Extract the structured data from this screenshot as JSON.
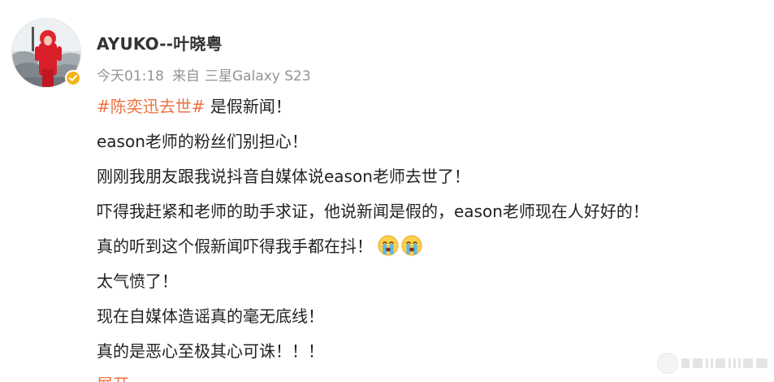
{
  "author": {
    "name": "AYUKO--叶晓粤",
    "verified_color": "#f5b319"
  },
  "meta": {
    "time": "今天01:18",
    "source_prefix": "来自",
    "device": "三星Galaxy S23"
  },
  "post": {
    "topic": "#陈奕迅去世#",
    "line1_rest": " 是假新闻！",
    "line2": "eason老师的粉丝们别担心！",
    "line3": "刚刚我朋友跟我说抖音自媒体说eason老师去世了！",
    "line4": "吓得我赶紧和老师的助手求证，他说新闻是假的，eason老师现在人好好的！",
    "line5": "真的听到这个假新闻吓得我手都在抖！",
    "line6": "太气愤了！",
    "line7": "现在自媒体造谣真的毫无底线！",
    "line8": "真的是恶心至极其心可诛！！！",
    "emojis": [
      "crying-face-icon",
      "crying-face-icon"
    ],
    "expand_label": "展开"
  },
  "colors": {
    "topic": "#eb7340",
    "meta": "#939393",
    "text": "#222222"
  }
}
